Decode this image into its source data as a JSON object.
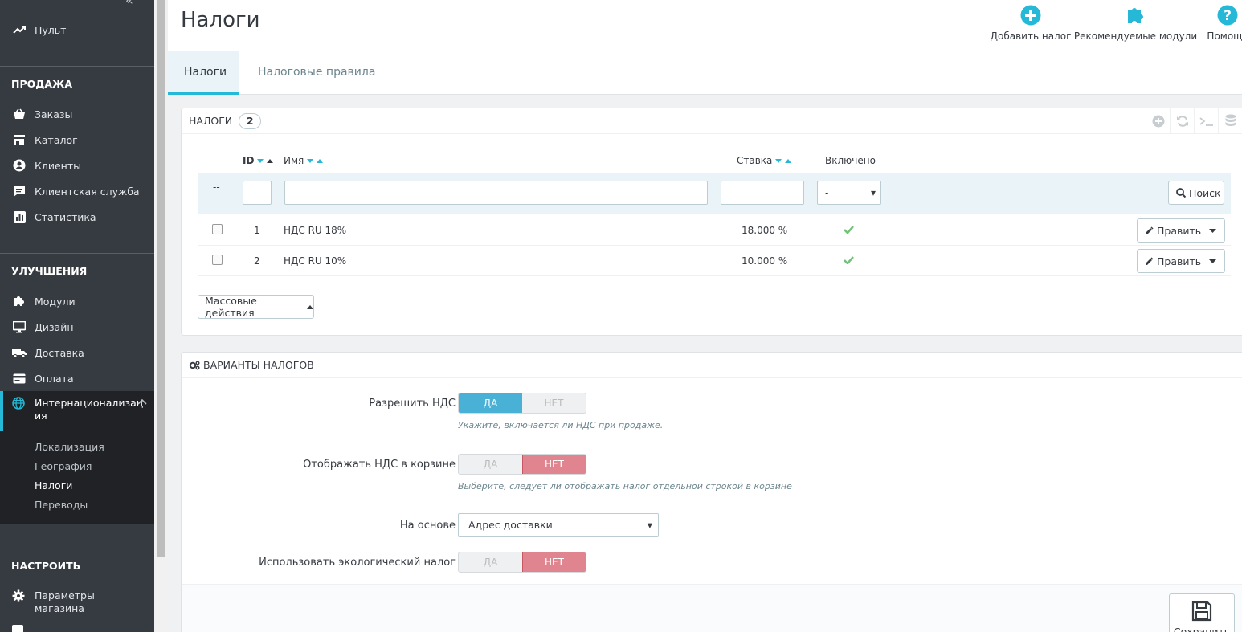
{
  "sidebar": {
    "collapse_icon": "double-chevron-left-icon",
    "dashboard": "Пульт",
    "sections": [
      {
        "title": "ПРОДАЖА",
        "items": [
          "Заказы",
          "Каталог",
          "Клиенты",
          "Клиентская служба",
          "Статистика"
        ]
      },
      {
        "title": "УЛУЧШЕНИЯ",
        "items": [
          "Модули",
          "Дизайн",
          "Доставка",
          "Оплата"
        ]
      },
      {
        "title": "НАСТРОИТЬ",
        "items": [
          "Параметры магазина"
        ]
      }
    ],
    "intl": {
      "label_line1": "Интернационализац",
      "label_line2": "ия",
      "sub": [
        "Локализация",
        "География",
        "Налоги",
        "Переводы"
      ],
      "active_sub": "Налоги"
    },
    "settings_line2": "магазина",
    "accent": "#25b9d7"
  },
  "header": {
    "title": "Налоги",
    "toolbar": {
      "add": "Добавить налог",
      "modules": "Рекомендуемые модули",
      "help": "Помощь"
    }
  },
  "tabs": [
    "Налоги",
    "Налоговые правила"
  ],
  "taxes_panel": {
    "title": "Налоги",
    "count": "2",
    "columns": {
      "id": "ID",
      "name": "Имя",
      "rate": "Ставка",
      "enabled": "Включено"
    },
    "filter": {
      "dash": "--",
      "enabled_value": "-",
      "search": "Поиск"
    },
    "rows": [
      {
        "id": "1",
        "name": "НДС RU 18%",
        "rate": "18.000 %",
        "enabled": true
      },
      {
        "id": "2",
        "name": "НДС RU 10%",
        "rate": "10.000 %",
        "enabled": true
      }
    ],
    "edit": "Править",
    "bulk": "Массовые действия"
  },
  "options_panel": {
    "title": "Варианты налогов",
    "yes": "ДА",
    "no": "НЕТ",
    "fields": [
      {
        "label": "Разрешить НДС",
        "value": "yes",
        "help": "Укажите, включается ли НДС при продаже."
      },
      {
        "label": "Отображать НДС в корзине",
        "value": "no",
        "help": "Выберите, следует ли отображать налог отдельной строкой в корзине"
      },
      {
        "label": "На основе",
        "value": "Адрес доставки"
      },
      {
        "label": "Использовать экологический налог",
        "value": "no"
      }
    ],
    "save": "Сохранить"
  }
}
